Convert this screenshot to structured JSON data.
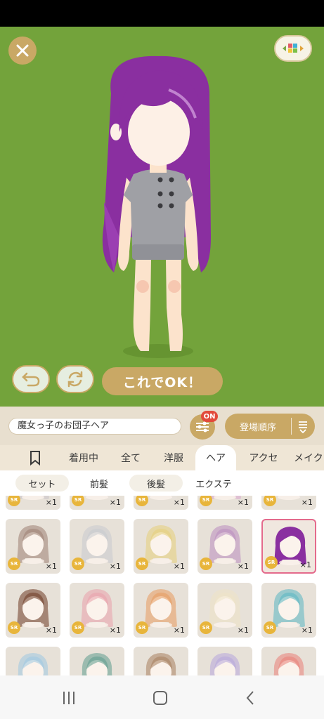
{
  "preview": {
    "ok_label": "これでOK！",
    "colors": {
      "background": "#73a33b",
      "hair": "#8a2fa0",
      "accent": "#c9a865"
    }
  },
  "filter_bar": {
    "item_name": "魔女っ子のお団子ヘア",
    "filter_badge": "ON",
    "sort_label": "登場順序"
  },
  "category_tabs": [
    {
      "label": "着用中",
      "active": false
    },
    {
      "label": "全て",
      "active": false
    },
    {
      "label": "洋服",
      "active": false
    },
    {
      "label": "ヘア",
      "active": true
    },
    {
      "label": "アクセ",
      "active": false
    },
    {
      "label": "メイク",
      "active": false
    }
  ],
  "sub_tabs": [
    {
      "label": "セット"
    },
    {
      "label": "前髪"
    },
    {
      "label": "後髪"
    },
    {
      "label": "エクステ"
    }
  ],
  "items": [
    {
      "rarity": "SR",
      "count": "×1",
      "hair_color": "#c9c2c8"
    },
    {
      "rarity": "SR",
      "count": "×1",
      "hair_color": "#e9e3de"
    },
    {
      "rarity": "SR",
      "count": "×1",
      "hair_color": "#e9e3de"
    },
    {
      "rarity": "SR",
      "count": "×1",
      "hair_color": "#d9a6d0"
    },
    {
      "rarity": "SR",
      "count": "×1",
      "hair_color": "#e9e3de"
    },
    {
      "rarity": "SR",
      "count": "×1",
      "hair_color": "#9c7f73"
    },
    {
      "rarity": "SR",
      "count": "×1",
      "hair_color": "#c9cbd0"
    },
    {
      "rarity": "SR",
      "count": "×1",
      "hair_color": "#e6cf7a"
    },
    {
      "rarity": "SR",
      "count": "×1",
      "hair_color": "#b98cc0"
    },
    {
      "rarity": "SR",
      "count": "×1",
      "hair_color": "#8a2fa0",
      "selected": true
    },
    {
      "rarity": "SR",
      "count": "×1",
      "hair_color": "#6e3a24"
    },
    {
      "rarity": "SR",
      "count": "×1",
      "hair_color": "#e9a0ac"
    },
    {
      "rarity": "SR",
      "count": "×1",
      "hair_color": "#e79a5e"
    },
    {
      "rarity": "SR",
      "count": "×1",
      "hair_color": "#efe3c7"
    },
    {
      "rarity": "SR",
      "count": "×1",
      "hair_color": "#5ab7c2"
    },
    {
      "rarity": "",
      "count": "",
      "hair_color": "#9fc9e2"
    },
    {
      "rarity": "",
      "count": "",
      "hair_color": "#5f9c8e"
    },
    {
      "rarity": "",
      "count": "",
      "hair_color": "#a7805e"
    },
    {
      "rarity": "",
      "count": "",
      "hair_color": "#b7a6dd"
    },
    {
      "rarity": "",
      "count": "",
      "hair_color": "#e97f78"
    }
  ]
}
